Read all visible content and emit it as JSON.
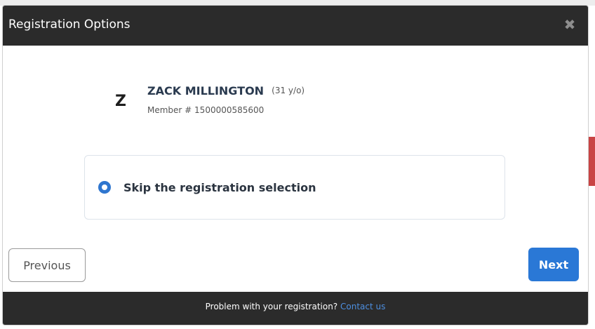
{
  "modal": {
    "title": "Registration Options",
    "close_glyph": "✖"
  },
  "member": {
    "initial": "Z",
    "name": "ZACK MILLINGTON",
    "age": "(31 y/o)",
    "id_text": "Member # 1500000585600"
  },
  "options": [
    {
      "label": "Skip the registration selection",
      "selected": true
    }
  ],
  "buttons": {
    "previous": "Previous",
    "next": "Next"
  },
  "footer": {
    "text": "Problem with your registration?",
    "link": "Contact us"
  },
  "colors": {
    "header_bg": "#2b2b2b",
    "primary": "#2a78d6",
    "link": "#4d8fe0",
    "accent_red": "#c94444"
  },
  "icons": {
    "close": "close-icon",
    "radio": "radio-selected-icon"
  }
}
